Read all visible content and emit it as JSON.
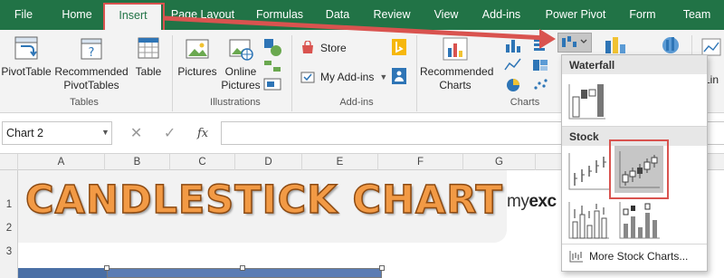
{
  "tabs": [
    {
      "label": "File"
    },
    {
      "label": "Home"
    },
    {
      "label": "Insert"
    },
    {
      "label": "Page Layout"
    },
    {
      "label": "Formulas"
    },
    {
      "label": "Data"
    },
    {
      "label": "Review"
    },
    {
      "label": "View"
    },
    {
      "label": "Add-ins"
    },
    {
      "label": "Power Pivot"
    },
    {
      "label": "Form"
    },
    {
      "label": "Team"
    }
  ],
  "ribbon": {
    "pivottable": "PivotTable",
    "recommended_pivottables": "Recommended PivotTables",
    "table": "Table",
    "pictures": "Pictures",
    "online_pictures": "Online Pictures",
    "store": "Store",
    "my_addins": "My Add-ins",
    "recommended_charts": "Recommended Charts",
    "line_partial": "Lin",
    "groups": {
      "tables": "Tables",
      "illustrations": "Illustrations",
      "addins": "Add-ins",
      "charts": "Charts"
    }
  },
  "formula_bar": {
    "name_box": "Chart 2",
    "fx": "fx"
  },
  "columns": [
    "A",
    "B",
    "C",
    "D",
    "E",
    "F",
    "G"
  ],
  "rows": [
    "1",
    "2",
    "3"
  ],
  "banner": {
    "title": "CANDLESTICK CHART"
  },
  "brand": {
    "prefix": "my",
    "bold": "exc"
  },
  "dropdown": {
    "waterfall_header": "Waterfall",
    "stock_header": "Stock",
    "more_link": "More Stock Charts..."
  },
  "colors": {
    "ribbon_green": "#217346",
    "highlight_red": "#d9534f",
    "banner_orange": "#f29a45"
  }
}
